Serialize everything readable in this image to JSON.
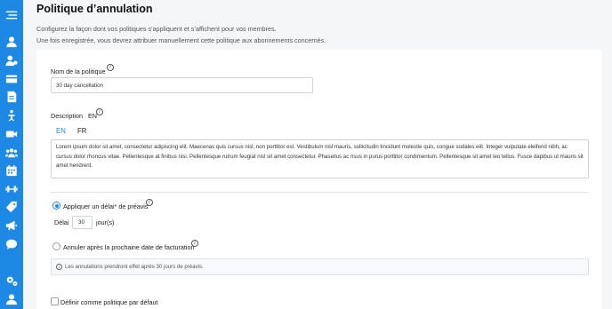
{
  "page": {
    "title": "Politique d’annulation",
    "description_line1": "Configurez la façon dont vos politiques s’appliquent et s’affichent pour vos membres.",
    "description_line2": "Une fois enregistrée, vous devrez attribuer manuellement cette politique aux abonnements concernés."
  },
  "sidebar": {
    "icons": [
      "menu-icon",
      "user-icon",
      "user-gear-icon",
      "credit-card-icon",
      "report-icon",
      "dumbbell-person-icon",
      "video-icon",
      "users-icon",
      "calendar-icon",
      "dumbbell-icon",
      "tag-icon",
      "megaphone-icon",
      "chat-icon",
      "settings-icon",
      "account-icon"
    ],
    "color": "#1e88e5"
  },
  "form": {
    "policy_name_label": "Nom de la politique",
    "policy_name_value": "30 day cancellation",
    "description_label": "Description",
    "description_lang": "EN",
    "tabs": [
      "EN",
      "FR"
    ],
    "description_text": "Lorem ipsum dolor sit amet, consectetur adipiscing elit. Maecenas quis cursus nisl, non porttitor est. Vestibulum nisl mauris, sollicitudin tincidunt molestie quis, congue sodales elit. Integer vulputate eleifend nibh, ac cursus dolor rhoncus vitae. Pellentesque at finibus nisi. Pellentesque rutrum feugiat nisl sit amet consectetur. Phasellus ac risus in purus porttitor condimentum. Pellentesque sit amet leo tellus. Fusce dapibus ut mauris sit amet hendrerit.",
    "option_notice_label": "Appliquer un délai* de préavis",
    "delay_label": "Délai",
    "delay_value": "30",
    "delay_unit": "jour(s)",
    "option_billing_label": "Annuler après la prochaine date de facturation",
    "notice_text": "Les annulations prendront effet après 30 jours de préavis.",
    "default_checkbox_label": "Définir comme politique par défaut"
  }
}
